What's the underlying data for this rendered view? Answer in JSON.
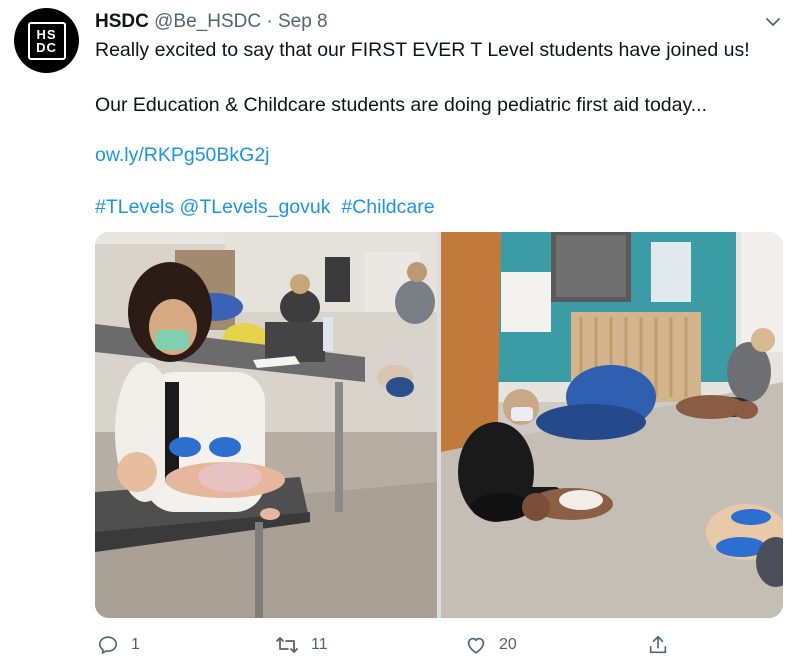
{
  "author": {
    "logo_text": [
      "HS",
      "DC"
    ],
    "name": "HSDC",
    "handle": "@Be_HSDC",
    "separator": "·",
    "date": "Sep 8"
  },
  "tweet": {
    "line1": "Really excited to say that our FIRST EVER T Level students have joined us!",
    "line2": "Our Education & Childcare students are doing pediatric first aid today...",
    "link": "ow.ly/RKPg50BkG2j",
    "hashtags": [
      "#TLevels",
      "@TLevels_govuk",
      "#Childcare"
    ]
  },
  "actions": {
    "reply_count": "1",
    "retweet_count": "11",
    "like_count": "20"
  },
  "icons": {
    "reply": "reply-icon",
    "retweet": "retweet-icon",
    "like": "heart-icon",
    "share": "share-icon",
    "more": "chevron-down-icon"
  },
  "colors": {
    "link": "#1b95e0",
    "text": "#0f1419",
    "muted": "#536471"
  }
}
